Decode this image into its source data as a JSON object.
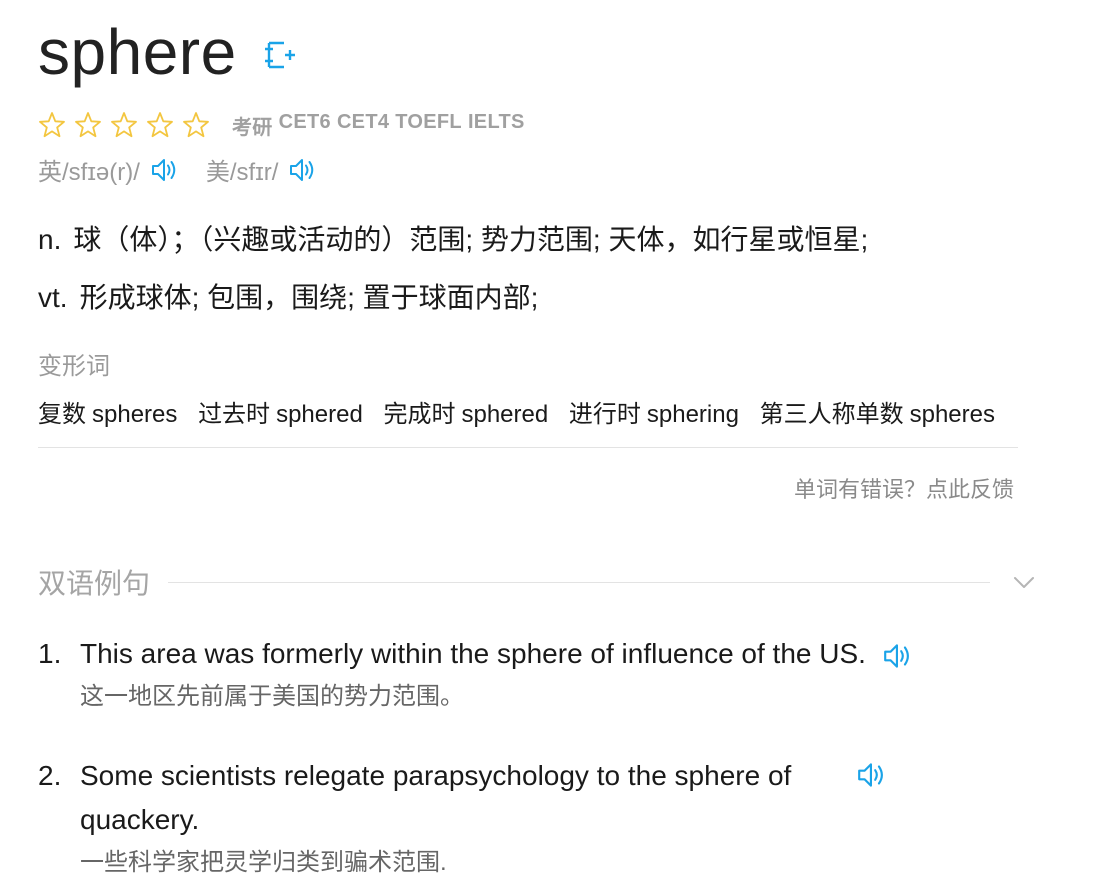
{
  "word": "sphere",
  "tags": [
    "考研",
    "CET6",
    "CET4",
    "TOEFL",
    "IELTS"
  ],
  "rating": {
    "filled": 0,
    "total": 5
  },
  "phonetics": {
    "uk": "英/sfɪə(r)/",
    "us": "美/sfɪr/"
  },
  "definitions": [
    {
      "pos": "n.",
      "text": "球（体）；（兴趣或活动的）范围; 势力范围; 天体，如行星或恒星;"
    },
    {
      "pos": "vt.",
      "text": "形成球体; 包围，围绕; 置于球面内部;"
    }
  ],
  "forms_title": "变形词",
  "forms": [
    {
      "label": "复数",
      "value": "spheres"
    },
    {
      "label": "过去时",
      "value": "sphered"
    },
    {
      "label": "完成时",
      "value": "sphered"
    },
    {
      "label": "进行时",
      "value": "sphering"
    },
    {
      "label": "第三人称单数",
      "value": "spheres"
    }
  ],
  "feedback": "单词有错误？点此反馈",
  "examples_section": {
    "title": "双语例句",
    "items": [
      {
        "num": "1.",
        "en": "This area was formerly within the sphere of influence of the US.",
        "zh": "这一地区先前属于美国的势力范围。"
      },
      {
        "num": "2.",
        "en": "Some scientists relegate parapsychology to the sphere of quackery.",
        "zh": "一些科学家把灵学归类到骗术范围."
      }
    ]
  },
  "colors": {
    "accent": "#1aa3e8",
    "star": "#f3c640",
    "muted": "#9a9a9a"
  }
}
